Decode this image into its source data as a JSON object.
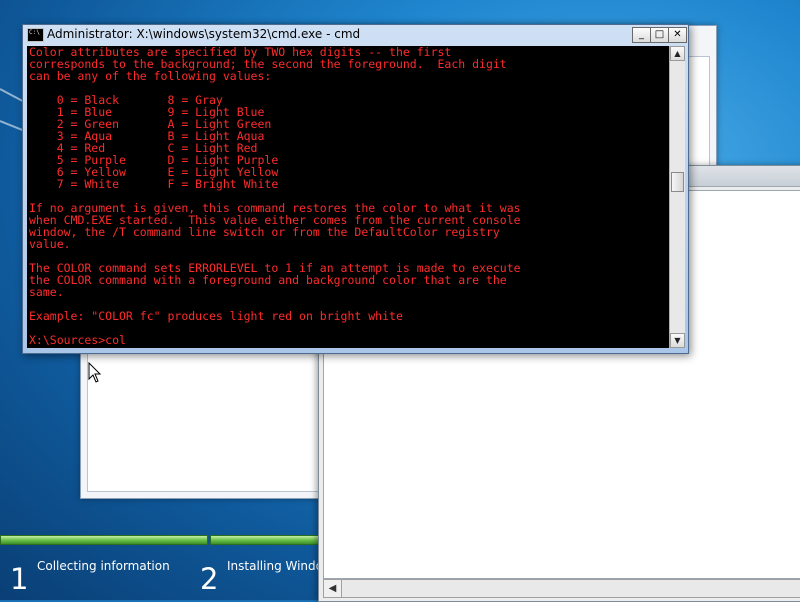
{
  "cmd": {
    "title": "Administrator: X:\\windows\\system32\\cmd.exe - cmd",
    "output": "Color attributes are specified by TWO hex digits -- the first\ncorresponds to the background; the second the foreground.  Each digit\ncan be any of the following values:\n\n    0 = Black       8 = Gray\n    1 = Blue        9 = Light Blue\n    2 = Green       A = Light Green\n    3 = Aqua        B = Light Aqua\n    4 = Red         C = Light Red\n    5 = Purple      D = Light Purple\n    6 = Yellow      E = Light Yellow\n    7 = White       F = Bright White\n\nIf no argument is given, this command restores the color to what it was\nwhen CMD.EXE started.  This value either comes from the current console\nwindow, the /T command line switch or from the DefaultColor registry\nvalue.\n\nThe COLOR command sets ERRORLEVEL to 1 if an attempt is made to execute\nthe COLOR command with a foreground and background color that are the\nsame.\n\nExample: \"COLOR fc\" produces light red on bright white\n\nX:\\Sources>col",
    "text_color": "#ff2b2b",
    "background_color": "#000000",
    "buttons": {
      "minimize": "_",
      "maximize": "□",
      "close": "✕"
    },
    "scroll_up": "▲",
    "scroll_down": "▼"
  },
  "setup_steps": [
    {
      "number": "1",
      "label": "Collecting information"
    },
    {
      "number": "2",
      "label": "Installing Windo"
    }
  ],
  "right_window": {
    "scroll_left": "◀"
  },
  "colors": {
    "progress_green": "#6cc24a",
    "desktop_blue": "#1b6fb4"
  }
}
